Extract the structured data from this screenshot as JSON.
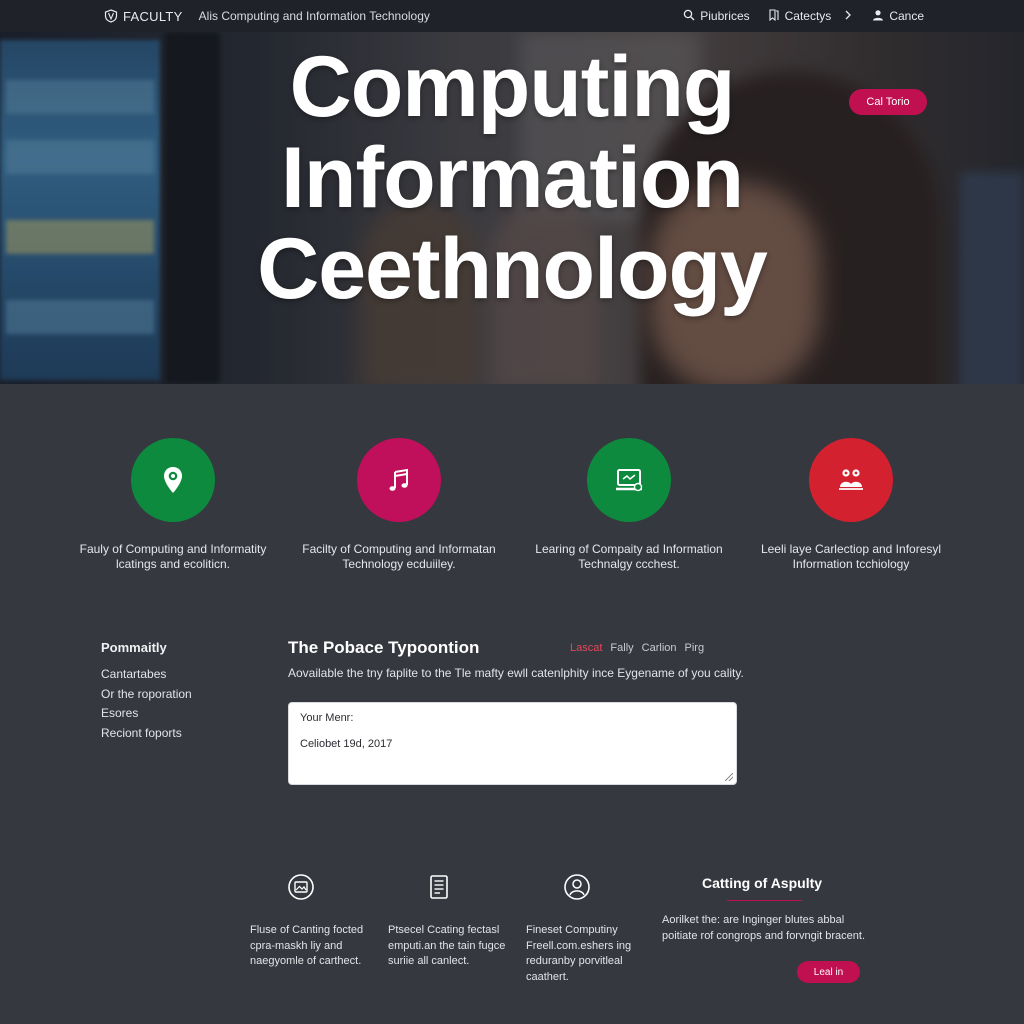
{
  "topbar": {
    "brand": "FACULTY",
    "breadcrumb": "Alis Computing and Information Technology",
    "nav": [
      {
        "label": "Piubrices",
        "icon": "search-icon"
      },
      {
        "label": "Catectys",
        "icon": "bookmark-icon"
      },
      {
        "label": "Cance",
        "icon": "user-icon"
      }
    ]
  },
  "hero": {
    "title_lines": [
      "Computing",
      "Information",
      "Ceethnology"
    ],
    "cta_label": "Cal Torio"
  },
  "features": [
    {
      "icon": "location-pin-icon",
      "color": "#0e8a3e",
      "text": "Fauly of Computing and Informatity lcatings and ecoliticn."
    },
    {
      "icon": "music-note-icon",
      "color": "#c0105c",
      "text": "Facilty of Computing and Informatan Technology ecduiiley."
    },
    {
      "icon": "laptop-icon",
      "color": "#0e8a3e",
      "text": "Learing of Compaity ad Information Technalgy ccchest."
    },
    {
      "icon": "people-icon",
      "color": "#d42130",
      "text": "Leeli laye Carlectiop and Inforesyl Information tcchiology"
    }
  ],
  "sidebar": {
    "heading": "Pommaitly",
    "items": [
      "Cantartabes",
      "Or the roporation",
      "Esores",
      "Reciont foports"
    ]
  },
  "section": {
    "title": "The Pobace Typoontion",
    "tabs": [
      "Lascat",
      "Fally",
      "Carlion",
      "Pirg"
    ],
    "description": "Aovailable the tny faplite to the Tle mafty ewll catenlphity ince Eygename of you cality.",
    "textbox_label": "Your Menr:",
    "textbox_value": "Celiobet 19d, 2017"
  },
  "cards": [
    {
      "icon": "image-badge-icon",
      "text": "Fluse of Canting focted cpra-maskh liy and naegyomle of carthect."
    },
    {
      "icon": "document-icon",
      "text": "Ptsecel Ccating fectasl emputi.an the tain fugce suriie all canlect."
    },
    {
      "icon": "user-circle-icon",
      "text": "Fineset Computiny Freell.com.eshers ing reduranby porvitleal caathert."
    }
  ],
  "aside": {
    "title": "Catting of Aspulty",
    "text": "Aorilket the: are Inginger blutes abbal poitiate rof congrops and forvngit bracent.",
    "button_label": "Leal in"
  }
}
